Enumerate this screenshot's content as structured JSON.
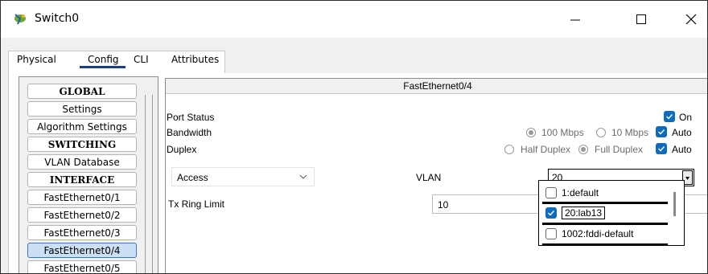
{
  "window": {
    "title": "Switch0",
    "controls": [
      "minimize-icon",
      "maximize-icon",
      "close-icon"
    ]
  },
  "tabs": [
    {
      "label": "Physical"
    },
    {
      "label": "Config",
      "active": true
    },
    {
      "label": "CLI"
    },
    {
      "label": "Attributes"
    }
  ],
  "sidebar": {
    "items": [
      {
        "label": "GLOBAL",
        "type": "header"
      },
      {
        "label": "Settings"
      },
      {
        "label": "Algorithm Settings"
      },
      {
        "label": "SWITCHING",
        "type": "header"
      },
      {
        "label": "VLAN Database"
      },
      {
        "label": "INTERFACE",
        "type": "header"
      },
      {
        "label": "FastEthernet0/1"
      },
      {
        "label": "FastEthernet0/2"
      },
      {
        "label": "FastEthernet0/3"
      },
      {
        "label": "FastEthernet0/4",
        "selected": true
      },
      {
        "label": "FastEthernet0/5"
      }
    ]
  },
  "panel": {
    "title": "FastEthernet0/4",
    "port_status": {
      "label": "Port Status",
      "on_label": "On",
      "checked": true
    },
    "bandwidth": {
      "label": "Bandwidth",
      "options": [
        "100 Mbps",
        "10 Mbps"
      ],
      "auto_label": "Auto",
      "auto_checked": true
    },
    "duplex": {
      "label": "Duplex",
      "options": [
        "Half Duplex",
        "Full Duplex"
      ],
      "auto_label": "Auto",
      "auto_checked": true
    },
    "mode_select": {
      "value": "Access"
    },
    "vlan": {
      "label": "VLAN",
      "value": "20"
    },
    "tx_ring": {
      "label": "Tx Ring Limit",
      "value": "10"
    },
    "vlan_options": [
      {
        "label": "1:default",
        "checked": false
      },
      {
        "label": "20:lab13",
        "checked": true
      },
      {
        "label": "1002:fddi-default",
        "checked": false
      }
    ]
  },
  "colors": {
    "accent": "#0f6cbd",
    "tab_underline": "#1b3e86",
    "selected_bg": "#cce0f5"
  }
}
